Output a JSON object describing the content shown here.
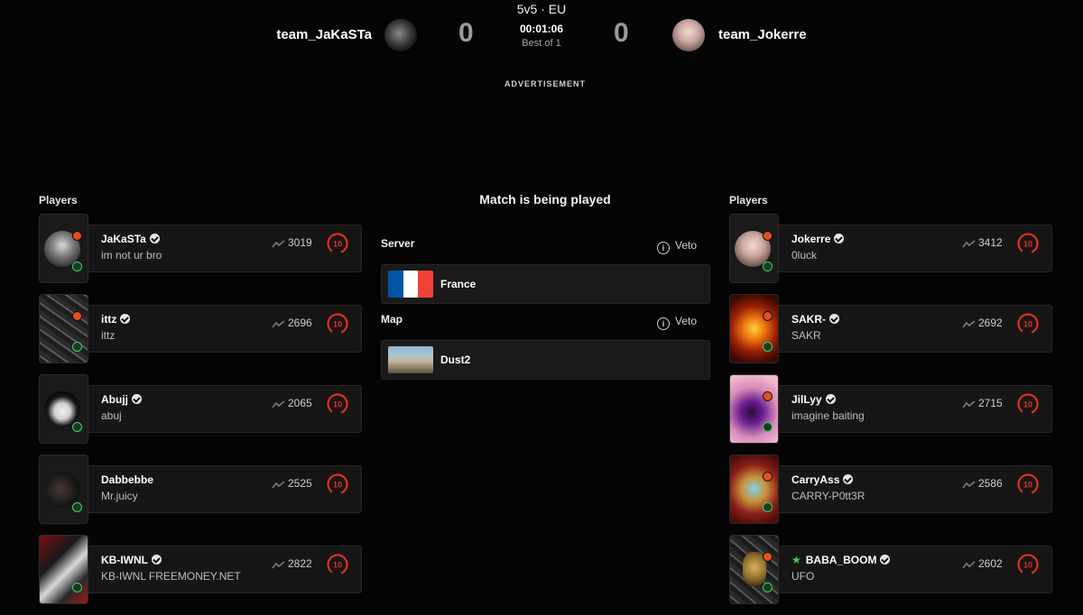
{
  "header": {
    "mode": "5v5 · EU",
    "timer": "00:01:06",
    "best_of": "Best of 1",
    "team_left": {
      "name": "team_JaKaSTa",
      "score": "0"
    },
    "team_right": {
      "name": "team_Jokerre",
      "score": "0"
    },
    "advertisement": "ADVERTISEMENT"
  },
  "match": {
    "status": "Match is being played",
    "server_label": "Server",
    "server_value": "France",
    "map_label": "Map",
    "map_value": "Dust2",
    "veto_label": "Veto",
    "info_glyph": "i"
  },
  "players_label": "Players",
  "left_players": [
    {
      "name": "JaKaSTa",
      "subtitle": "im not ur bro",
      "elo": "3019",
      "level": "10"
    },
    {
      "name": "ittz",
      "subtitle": "ittz",
      "elo": "2696",
      "level": "10"
    },
    {
      "name": "Abujj",
      "subtitle": "abuj",
      "elo": "2065",
      "level": "10"
    },
    {
      "name": "Dabbebbe",
      "subtitle": "Mr.juicy",
      "elo": "2525",
      "level": "10"
    },
    {
      "name": "KB-IWNL",
      "subtitle": "KB-IWNL FREEMONEY.NET",
      "elo": "2822",
      "level": "10"
    }
  ],
  "right_players": [
    {
      "name": "Jokerre",
      "subtitle": "0luck",
      "elo": "3412",
      "level": "10"
    },
    {
      "name": "SAKR-",
      "subtitle": "SAKR",
      "elo": "2692",
      "level": "10"
    },
    {
      "name": "JilLyy",
      "subtitle": "imagine baiting",
      "elo": "2715",
      "level": "10"
    },
    {
      "name": "CarryAss",
      "subtitle": "CARRY-P0tt3R",
      "elo": "2586",
      "level": "10"
    },
    {
      "name": "BABA_BOOM",
      "subtitle": "UFO",
      "elo": "2602",
      "level": "10"
    }
  ],
  "icons": {
    "verified": "verified-badge-icon",
    "elo": "elo-trend-icon",
    "level": "skill-level-10-icon",
    "info": "info-icon",
    "star": "star-icon"
  },
  "colors": {
    "background": "#050505",
    "card": "#161616",
    "level_red": "#e0301e",
    "online_green": "#3ed06a",
    "star_green": "#36d05b",
    "flag_blue": "#0055a4",
    "flag_white": "#ffffff",
    "flag_red": "#ef4135"
  }
}
